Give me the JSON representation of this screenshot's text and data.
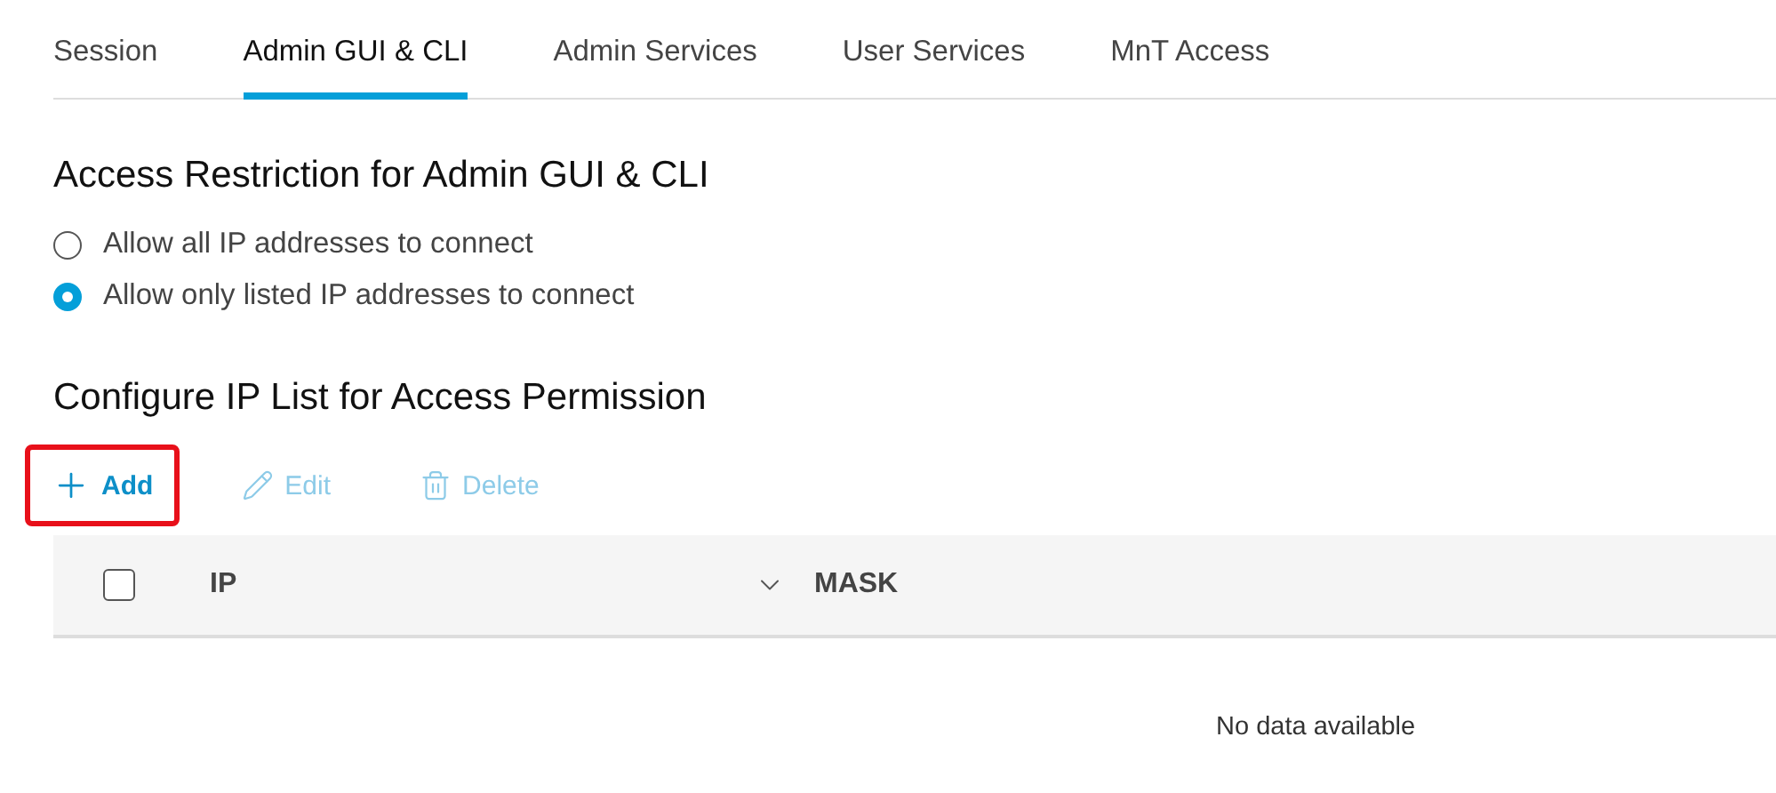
{
  "tabs": [
    {
      "label": "Session",
      "selected": false
    },
    {
      "label": "Admin GUI & CLI",
      "selected": true
    },
    {
      "label": "Admin Services",
      "selected": false
    },
    {
      "label": "User Services",
      "selected": false
    },
    {
      "label": "MnT Access",
      "selected": false
    }
  ],
  "access_restriction": {
    "title": "Access Restriction for Admin GUI & CLI",
    "options": [
      {
        "label": "Allow all IP addresses to connect",
        "selected": false
      },
      {
        "label": "Allow only listed IP addresses to connect",
        "selected": true
      }
    ]
  },
  "ip_list": {
    "title": "Configure IP List for Access Permission",
    "actions": [
      {
        "kind": "add",
        "label": "Add",
        "disabled": false,
        "highlighted": true
      },
      {
        "kind": "edit",
        "label": "Edit",
        "disabled": true,
        "highlighted": false
      },
      {
        "kind": "delete",
        "label": "Delete",
        "disabled": true,
        "highlighted": false
      }
    ],
    "table": {
      "select_all": {
        "checked": false
      },
      "columns": [
        {
          "label": "IP",
          "dropdown": true
        },
        {
          "label": "MASK",
          "dropdown": false
        }
      ],
      "empty_message": "No data available"
    }
  }
}
